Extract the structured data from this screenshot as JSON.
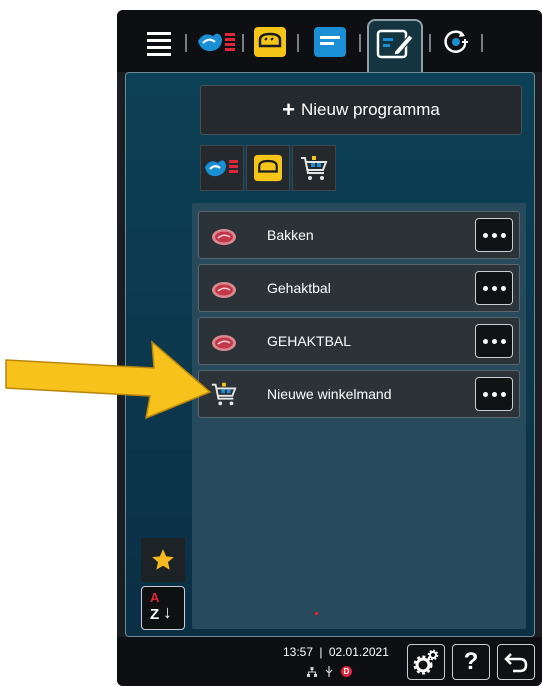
{
  "topbar": {
    "tabs": [
      {
        "name": "menu",
        "icon": "hamburger-menu-icon"
      },
      {
        "name": "meat-wave",
        "icon": "meat-wave-icon"
      },
      {
        "name": "bread",
        "icon": "bread-icon"
      },
      {
        "name": "list",
        "icon": "list-icon"
      },
      {
        "name": "edit",
        "icon": "edit-pencil-icon",
        "active": true
      },
      {
        "name": "refresh",
        "icon": "refresh-plus-icon"
      }
    ]
  },
  "main": {
    "new_program_plus": "+",
    "new_program_label": "Nieuw programma",
    "filters": [
      {
        "icon": "meat-wave-icon"
      },
      {
        "icon": "bread-icon"
      },
      {
        "icon": "shopping-cart-icon"
      }
    ],
    "items": [
      {
        "label": "Bakken",
        "icon": "meat-icon"
      },
      {
        "label": "Gehaktbal",
        "icon": "meat-icon"
      },
      {
        "label": "GEHAKTBAL",
        "icon": "meat-icon"
      },
      {
        "label": "Nieuwe winkelmand",
        "icon": "shopping-cart-icon"
      }
    ]
  },
  "sidebar": {
    "favorite_icon": "star-icon",
    "sort_label_top": "A",
    "sort_label_bottom": "Z",
    "sort_arrow": "↓"
  },
  "bottombar": {
    "time": "13:57",
    "separator": "|",
    "date": "02.01.2021",
    "status_badge": "D",
    "help_label": "?"
  },
  "colors": {
    "accent_blue": "#1a8fd6",
    "accent_yellow": "#f5c518",
    "accent_red": "#e0263b",
    "arrow_yellow": "#f7c21c"
  }
}
